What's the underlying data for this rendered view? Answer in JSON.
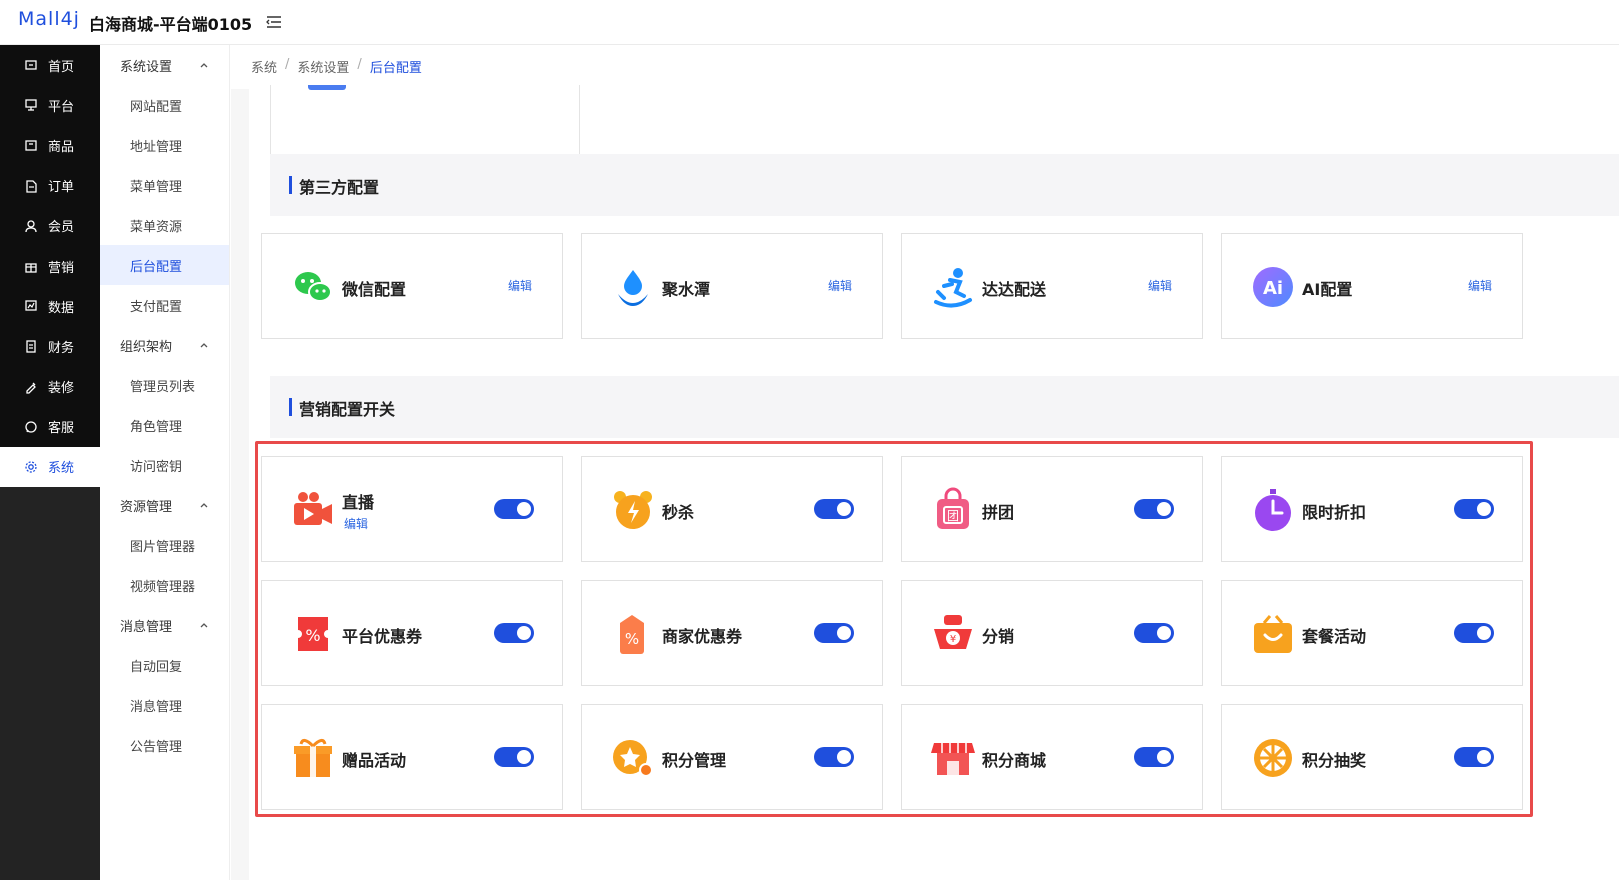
{
  "header": {
    "logo": "Mall4j",
    "title": "白海商城-平台端0105"
  },
  "mainnav": {
    "items": [
      {
        "label": "首页",
        "icon": "home-icon"
      },
      {
        "label": "平台",
        "icon": "monitor-icon"
      },
      {
        "label": "商品",
        "icon": "box-icon"
      },
      {
        "label": "订单",
        "icon": "document-icon"
      },
      {
        "label": "会员",
        "icon": "user-group-icon"
      },
      {
        "label": "营销",
        "icon": "gift-icon"
      },
      {
        "label": "数据",
        "icon": "chart-icon"
      },
      {
        "label": "财务",
        "icon": "ledger-icon"
      },
      {
        "label": "装修",
        "icon": "brush-icon"
      },
      {
        "label": "客服",
        "icon": "chat-icon"
      },
      {
        "label": "系统",
        "icon": "gear-icon"
      }
    ],
    "active": "系统"
  },
  "subnav": {
    "groups": [
      {
        "label": "系统设置",
        "items": [
          "网站配置",
          "地址管理",
          "菜单管理",
          "菜单资源",
          "后台配置",
          "支付配置"
        ]
      },
      {
        "label": "组织架构",
        "items": [
          "管理员列表",
          "角色管理",
          "访问密钥"
        ]
      },
      {
        "label": "资源管理",
        "items": [
          "图片管理器",
          "视频管理器"
        ]
      },
      {
        "label": "消息管理",
        "items": [
          "自动回复",
          "消息管理",
          "公告管理"
        ]
      }
    ],
    "active": "后台配置"
  },
  "breadcrumb": [
    "系统",
    "系统设置",
    "后台配置"
  ],
  "sections": {
    "third_party": {
      "title": "第三方配置",
      "cards": [
        {
          "name": "微信配置",
          "edit": "编辑",
          "icon": "wechat-icon"
        },
        {
          "name": "聚水潭",
          "edit": "编辑",
          "icon": "water-drop-icon"
        },
        {
          "name": "达达配送",
          "edit": "编辑",
          "icon": "delivery-rider-icon"
        },
        {
          "name": "AI配置",
          "edit": "编辑",
          "icon": "ai-icon"
        }
      ]
    },
    "marketing": {
      "title": "营销配置开关",
      "cards": [
        {
          "name": "直播",
          "edit": "编辑",
          "icon": "live-camera-icon",
          "enabled": true
        },
        {
          "name": "秒杀",
          "icon": "alarm-clock-icon",
          "enabled": true
        },
        {
          "name": "拼团",
          "icon": "group-bag-icon",
          "enabled": true
        },
        {
          "name": "限时折扣",
          "icon": "stopwatch-icon",
          "enabled": true
        },
        {
          "name": "平台优惠券",
          "icon": "coupon-icon",
          "enabled": true
        },
        {
          "name": "商家优惠券",
          "icon": "tag-coupon-icon",
          "enabled": true
        },
        {
          "name": "分销",
          "icon": "red-packet-icon",
          "enabled": true
        },
        {
          "name": "套餐活动",
          "icon": "shopping-bag-icon",
          "enabled": true
        },
        {
          "name": "赠品活动",
          "icon": "gift-box-icon",
          "enabled": true
        },
        {
          "name": "积分管理",
          "icon": "star-coin-icon",
          "enabled": true
        },
        {
          "name": "积分商城",
          "icon": "store-icon",
          "enabled": true
        },
        {
          "name": "积分抽奖",
          "icon": "lottery-wheel-icon",
          "enabled": true
        }
      ]
    }
  },
  "colors": {
    "accent": "#1f4fdd",
    "highlight_border": "#e84a4a",
    "nav_bg": "#0e0e0e"
  }
}
